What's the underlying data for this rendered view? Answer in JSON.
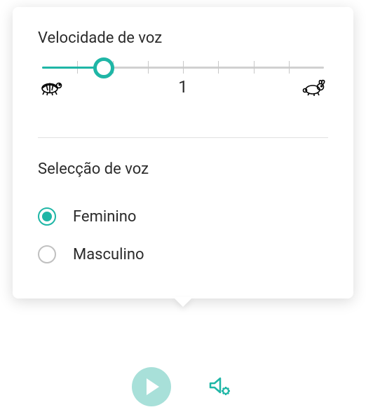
{
  "speed": {
    "title": "Velocidade de voz",
    "centerLabel": "1",
    "position": 0.22
  },
  "voice": {
    "title": "Selecção de voz",
    "options": [
      {
        "label": "Feminino",
        "selected": true
      },
      {
        "label": "Masculino",
        "selected": false
      }
    ]
  },
  "colors": {
    "accent": "#1fb6a6",
    "playBg": "#a8e0d9"
  }
}
